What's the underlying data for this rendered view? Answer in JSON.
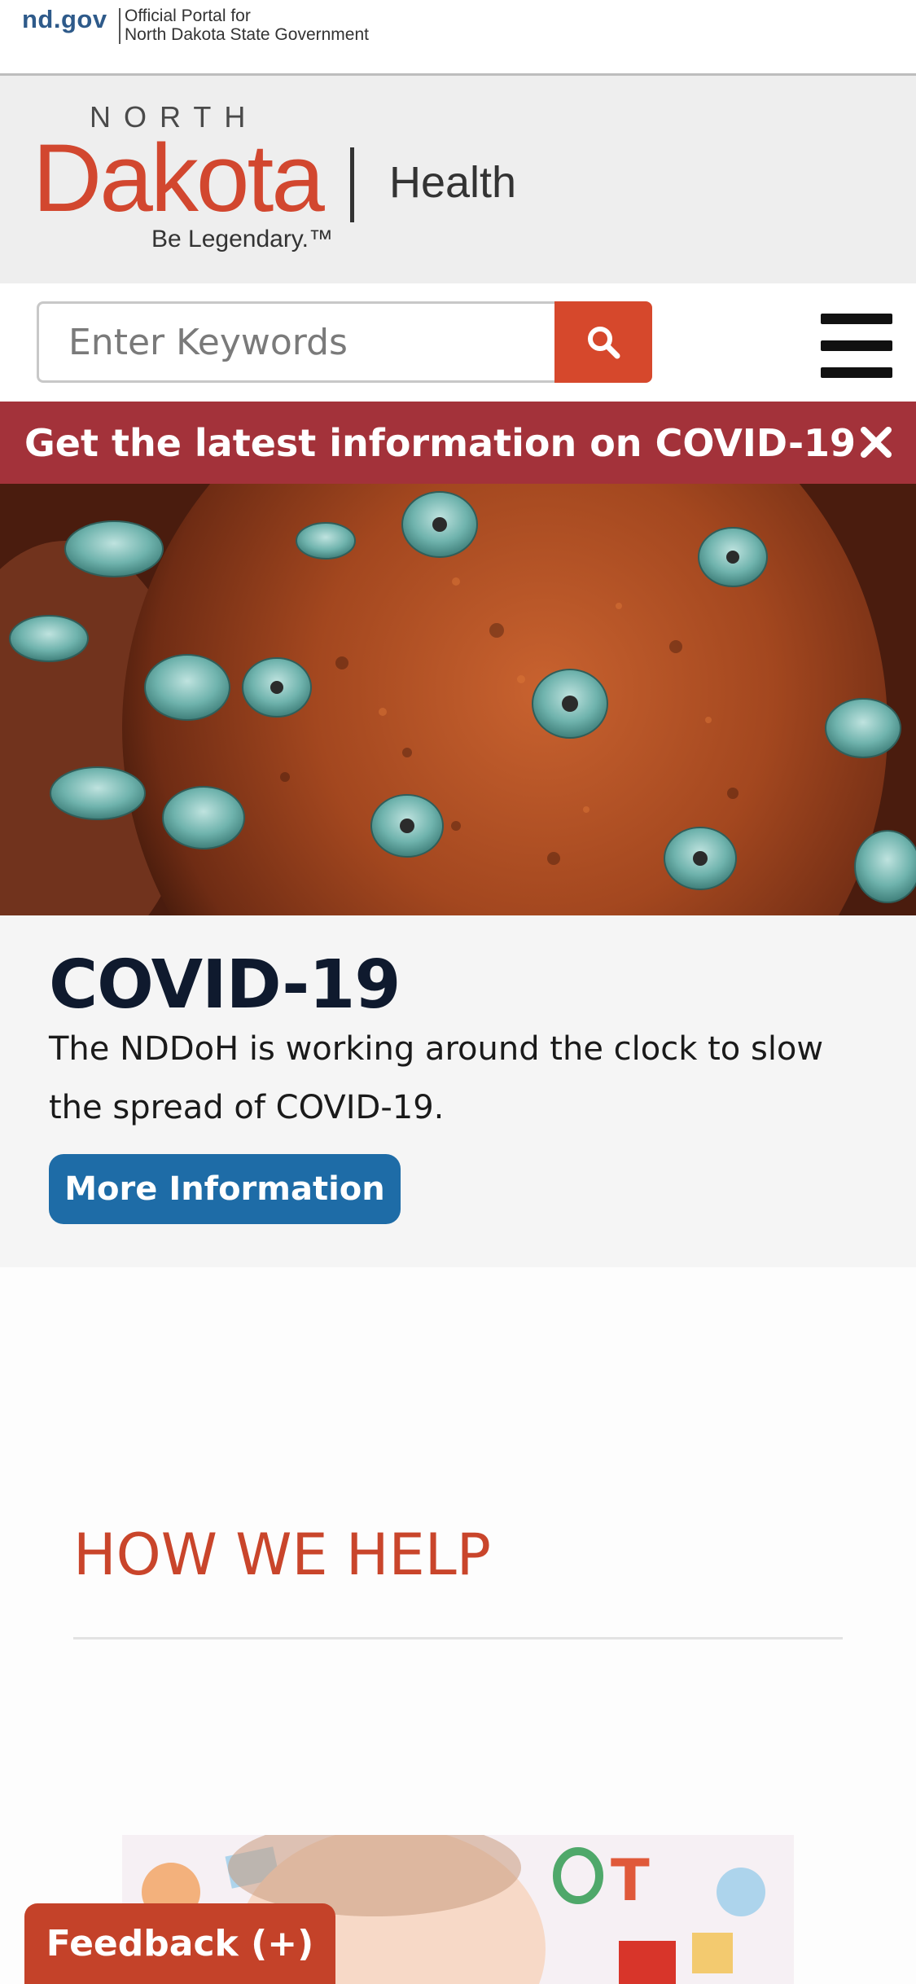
{
  "gov_bar": {
    "domain": "nd.gov",
    "portal_line1": "Official Portal for",
    "portal_line2": "North Dakota State Government"
  },
  "logo": {
    "north": "NORTH",
    "dakota": "Dakota",
    "department": "Health",
    "tagline": "Be Legendary.™"
  },
  "search": {
    "placeholder": "Enter Keywords",
    "value": ""
  },
  "alert": {
    "text": "Get the latest information on COVID-19"
  },
  "covid": {
    "title": "COVID-19",
    "body": "The NDDoH is working around the clock to slow the spread of COVID-19.",
    "button_label": "More Information"
  },
  "how_we_help": {
    "heading": "HOW WE HELP"
  },
  "feedback": {
    "label": "Feedback (+)"
  },
  "icons": {
    "search": "search-icon",
    "menu": "hamburger-menu-icon",
    "close": "close-icon"
  },
  "colors": {
    "brand_red": "#d2472f",
    "alert_red": "#a3323a",
    "button_blue": "#1e6ca7",
    "heading_navy": "#0f1a2e",
    "feedback_red": "#c44229"
  }
}
